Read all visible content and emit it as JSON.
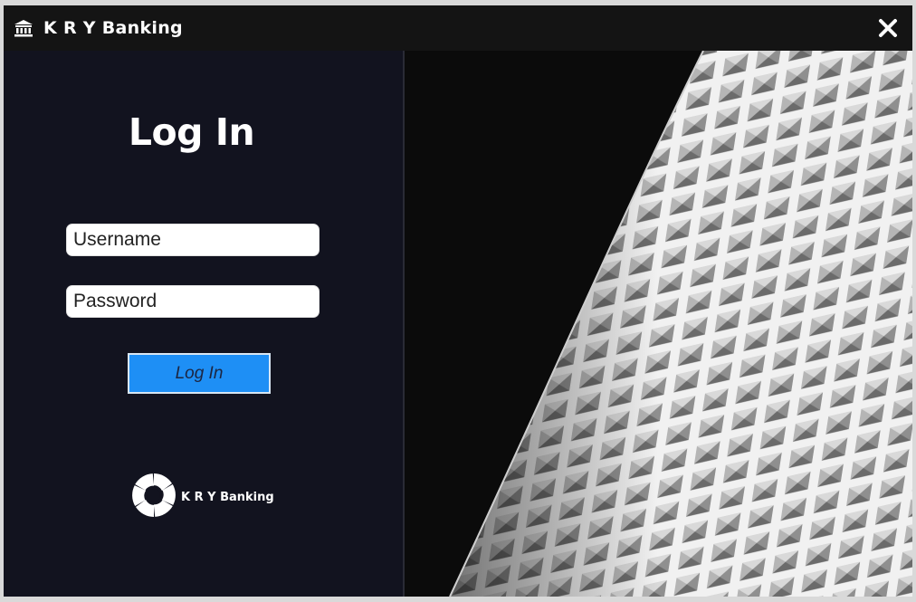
{
  "window": {
    "title": "K R Y Banking",
    "title_icon": "bank-icon",
    "close_icon": "close-icon"
  },
  "login": {
    "heading": "Log In",
    "username_placeholder": "Username",
    "password_placeholder": "Password",
    "button_label": "Log In"
  },
  "brand": {
    "logo_icon": "swirl-logo-icon",
    "name": "K R Y Banking"
  },
  "colors": {
    "panel_background": "#12131f",
    "titlebar_background": "#141414",
    "button_blue": "#1e8ff5"
  }
}
